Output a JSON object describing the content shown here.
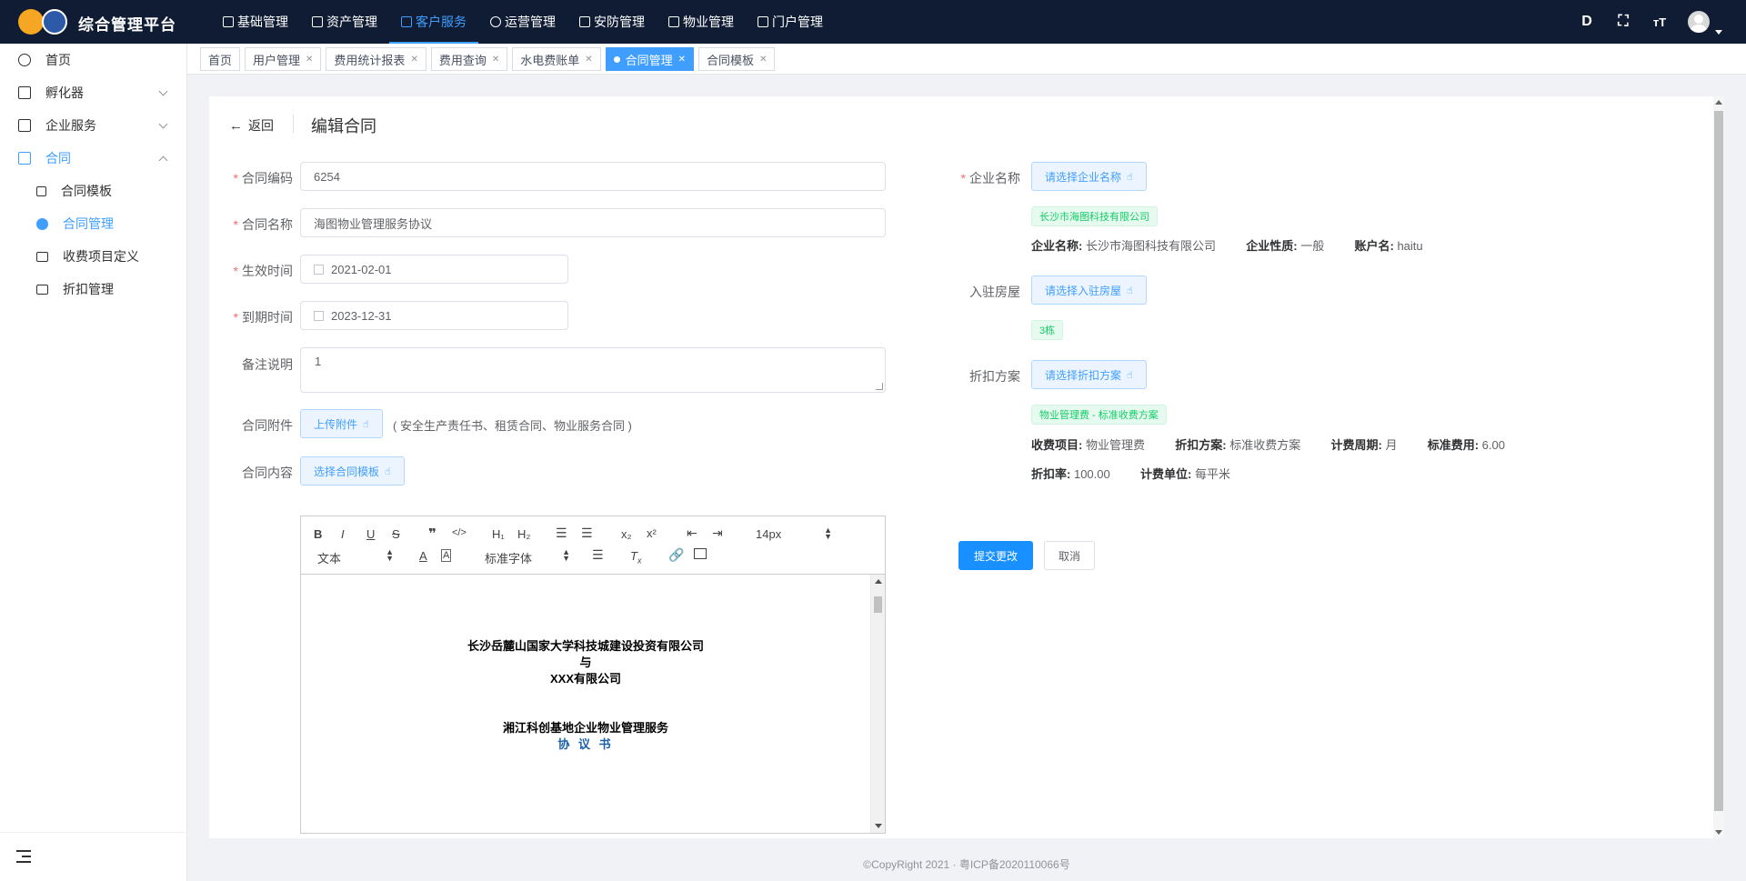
{
  "header": {
    "brand": "综合管理平台",
    "nav": [
      "基础管理",
      "资产管理",
      "客户服务",
      "运营管理",
      "安防管理",
      "物业管理",
      "门户管理"
    ],
    "active_nav": "客户服务",
    "right_icons": [
      "D",
      "⛶",
      "ᴛT"
    ]
  },
  "sidebar": {
    "items": [
      {
        "label": "首页"
      },
      {
        "label": "孵化器"
      },
      {
        "label": "企业服务"
      },
      {
        "label": "合同"
      },
      {
        "label": "合同模板"
      },
      {
        "label": "合同管理"
      },
      {
        "label": "收费项目定义"
      },
      {
        "label": "折扣管理"
      }
    ]
  },
  "tags": [
    {
      "label": "首页",
      "closable": false
    },
    {
      "label": "用户管理",
      "closable": true
    },
    {
      "label": "费用统计报表",
      "closable": true
    },
    {
      "label": "费用查询",
      "closable": true
    },
    {
      "label": "水电费账单",
      "closable": true
    },
    {
      "label": "合同管理",
      "closable": true
    },
    {
      "label": "合同模板",
      "closable": true
    }
  ],
  "page": {
    "back_label": "返回",
    "title": "编辑合同"
  },
  "form": {
    "code_label": "合同编码",
    "code_value": "6254",
    "name_label": "合同名称",
    "name_value": "海图物业管理服务协议",
    "start_label": "生效时间",
    "start_value": "2021-02-01",
    "end_label": "到期时间",
    "end_value": "2023-12-31",
    "remark_label": "备注说明",
    "remark_value": "1",
    "attach_label": "合同附件",
    "attach_button": "上传附件",
    "attach_hint": "( 安全生产责任书、租赁合同、物业服务合同 )",
    "content_label": "合同内容",
    "content_button": "选择合同模板"
  },
  "editor": {
    "font_size": "14px",
    "block_type": "文本",
    "font_family": "标准字体",
    "doc_lines": [
      "长沙岳麓山国家大学科技城建设投资有限公司",
      "与",
      "XXX有限公司",
      "湘江科创基地企业物业管理服务",
      "协 议 书"
    ]
  },
  "right": {
    "company_label": "企业名称",
    "company_button": "请选择企业名称",
    "company_tag": "长沙市海图科技有限公司",
    "company_info": {
      "name_k": "企业名称:",
      "name_v": "长沙市海图科技有限公司",
      "nature_k": "企业性质:",
      "nature_v": "一般",
      "account_k": "账户名:",
      "account_v": "haitu"
    },
    "room_label": "入驻房屋",
    "room_button": "请选择入驻房屋",
    "room_tag": "3栋",
    "discount_label": "折扣方案",
    "discount_button": "请选择折扣方案",
    "discount_tag": "物业管理费 - 标准收费方案",
    "discount_info": {
      "item_k": "收费项目:",
      "item_v": "物业管理费",
      "plan_k": "折扣方案:",
      "plan_v": "标准收费方案",
      "period_k": "计费周期:",
      "period_v": "月",
      "std_k": "标准费用:",
      "std_v": "6.00",
      "rate_k": "折扣率:",
      "rate_v": "100.00",
      "unit_k": "计费单位:",
      "unit_v": "每平米"
    },
    "submit": "提交更改",
    "cancel": "取消"
  },
  "footer": "©CopyRight 2021 · 粤ICP备2020110066号",
  "colors": {
    "primary": "#409eff",
    "header_bg": "#0f1c33",
    "success": "#13ce66",
    "required": "#f56c6c"
  }
}
